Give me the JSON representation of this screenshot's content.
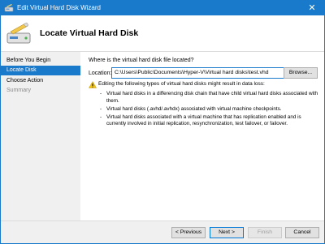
{
  "window": {
    "title": "Edit Virtual Hard Disk Wizard",
    "close_glyph": "✕"
  },
  "header": {
    "title": "Locate Virtual Hard Disk",
    "icon": "disk-wizard-icon"
  },
  "sidebar": {
    "items": [
      {
        "label": "Before You Begin",
        "state": "normal"
      },
      {
        "label": "Locate Disk",
        "state": "active"
      },
      {
        "label": "Choose Action",
        "state": "normal"
      },
      {
        "label": "Summary",
        "state": "disabled"
      }
    ]
  },
  "content": {
    "question": "Where is the virtual hard disk file located?",
    "location_label": "Location:",
    "location_value": "C:\\Users\\Public\\Documents\\Hyper-V\\Virtual hard disks\\test.vhd",
    "browse_label": "Browse...",
    "warning_title": "Editing the following types of virtual hard disks might result in data loss:",
    "bullets": [
      "Virtual hard disks in a differencing disk chain that have child virtual hard disks associated with them.",
      "Virtual hard disks (.avhd/.avhdx) associated with virtual machine checkpoints.",
      "Virtual hard disks associated with a virtual machine that has replication enabled and is currently involved in initial replication, resynchronization, test failover, or failover."
    ]
  },
  "footer": {
    "previous_label": "< Previous",
    "next_label": "Next >",
    "finish_label": "Finish",
    "cancel_label": "Cancel"
  },
  "colors": {
    "accent": "#1979ca",
    "warning": "#f0c419"
  }
}
